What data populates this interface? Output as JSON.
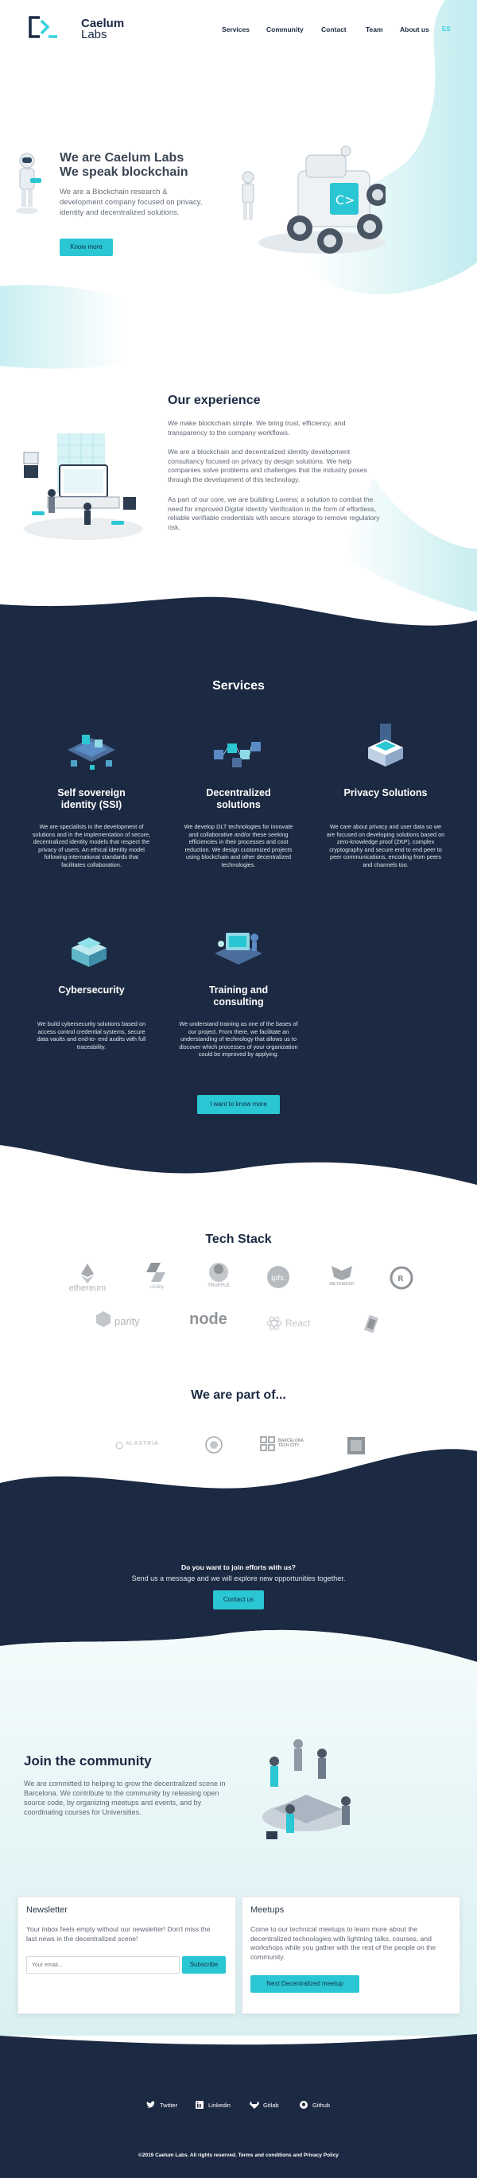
{
  "header": {
    "logo_title": "Caelum",
    "logo_subtitle": "Labs",
    "nav": [
      "Services",
      "Community",
      "Contact",
      "Team",
      "About us"
    ],
    "lang": "ES"
  },
  "hero": {
    "title_line1": "We are Caelum Labs",
    "title_line2": "We speak blockchain",
    "description": "We are a Blockchain research & development company focused on privacy, identity and decentralized solutions.",
    "button": "Know more"
  },
  "experience": {
    "title": "Our experience",
    "paragraphs": [
      "We make blockchain simple. We bring trust, efficiency, and transparency to the company workflows.",
      "We are a blockchain and decentralized identity development consultancy focused on privacy by design solutions. We help companies solve problems and challenges that the industry poses through the development of this technology.",
      "As part of our core, we are building Lorena; a solution to combat the need for improved  Digital Identity Verification in the form of effortless, reliable verifiable credentials with secure storage to remove regulatory risk."
    ]
  },
  "services": {
    "title": "Services",
    "items": [
      {
        "title": "Self sovereign identity (SSI)",
        "description": "We are specialists in the development of solutions and in the implementation of secure, decentralized identity models that respect the privacy of users. An ethical identity model following international standards that facilitates collaboration."
      },
      {
        "title": "Decentralized solutions",
        "description": "We develop DLT technologies for innovate and collaborative and/or these seeking efficiencies in their processes and cost reduction. We design customized projects using blockchain and other decentralized technologies."
      },
      {
        "title": "Privacy Solutions",
        "description": "We care about privacy and user data so we are focused on developing solutions based on zero-knowledge proof (ZKP), complex cryptography and secure end to end peer to peer communications, encoding from peers and channels too."
      },
      {
        "title": "Cybersecurity",
        "description": "We build cybersecurity solutions based on access control credential systems, secure data vaults and end-to- end audits with full traceability."
      },
      {
        "title": "Training and consulting",
        "description": "We understand training as one of the bases of our project. From there, we facilitate an understanding of technology that allows us to discover which processes of your organization could be improved by applying."
      }
    ],
    "button": "I want to know more"
  },
  "tech": {
    "title": "Tech Stack",
    "logos": [
      "ethereum",
      "solidity",
      "TRUFFLE",
      "ipfs",
      "METAMASK",
      "rust",
      "parity",
      "node",
      "React",
      "polkadot"
    ]
  },
  "partof": {
    "title": "We are part of...",
    "logos": [
      "ALASTRIA",
      "seal",
      "BARCELONA TECH CITY",
      "cube"
    ]
  },
  "cta": {
    "title": "Do you want to join efforts with us?",
    "subtitle": "Send us a message and we will explore new opportunities together.",
    "button": "Contact us"
  },
  "community": {
    "title": "Join the community",
    "description": "We are committed to helping to grow the decentralized scene in Barcelona. We contribute to the community by releasing open source code, by organizing meetups and events, and by coordinating courses for Universities."
  },
  "newsletter": {
    "title": "Newsletter",
    "text": "Your inbox feels empty without our newsletter! Don't miss the last news in the decentralized scene!",
    "placeholder": "Your email...",
    "button": "Subscribe"
  },
  "meetups": {
    "title": "Meetups",
    "text": "Come to our technical meetups to learn more about the decentralized technologies with lightning talks, courses, and workshops while you gather with the rest of the people on the community.",
    "button": "Next Decentralized meetup"
  },
  "footer": {
    "links": [
      "Twitter",
      "Linkedin",
      "Gitlab",
      "Github"
    ],
    "copyright": "©2019 Caelum Labs. All rights reserved. Terms and conditions and Privacy Policy"
  },
  "colors": {
    "navy": "#1c2942",
    "accent": "#2bc6d3",
    "teal_light": "#dff4f6"
  }
}
